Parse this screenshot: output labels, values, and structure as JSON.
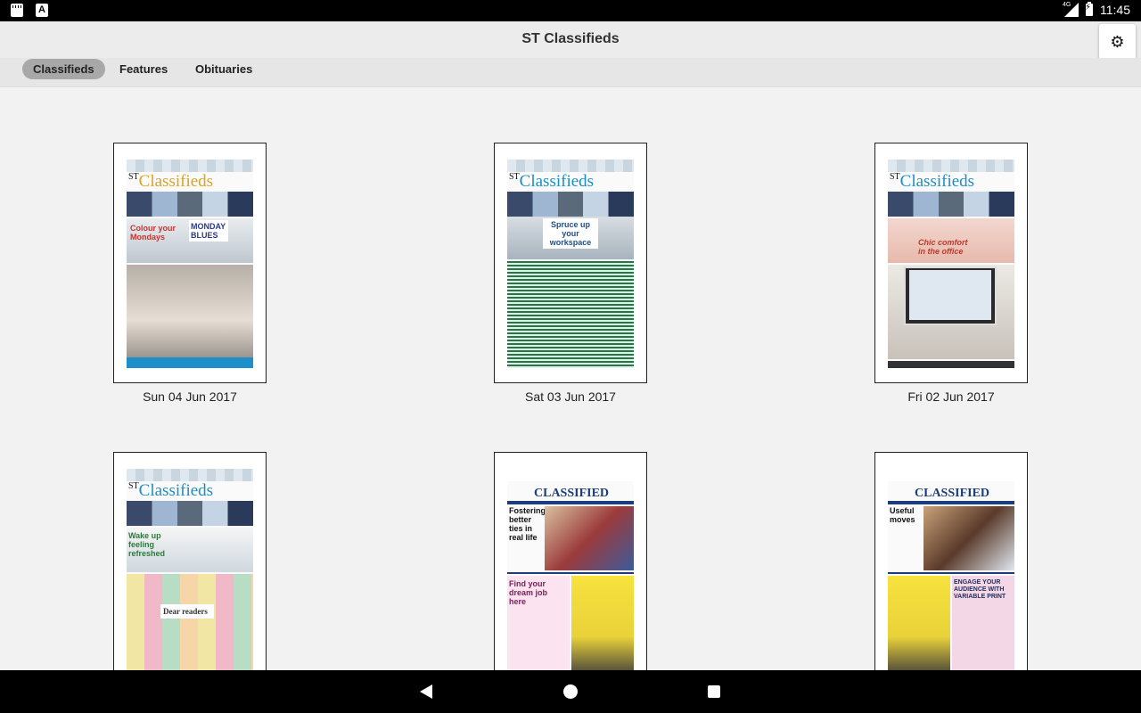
{
  "status_bar": {
    "time": "11:45",
    "network": "4G"
  },
  "header": {
    "title": "ST Classifieds",
    "settings_icon": "gear-icon"
  },
  "tabs": [
    {
      "label": "Classifieds",
      "active": true
    },
    {
      "label": "Features",
      "active": false
    },
    {
      "label": "Obituaries",
      "active": false
    }
  ],
  "editions": [
    {
      "date": "Sun 04 Jun 2017",
      "masthead": "Classifieds",
      "headline": "Colour your Mondays",
      "sub": "MONDAY BLUES"
    },
    {
      "date": "Sat 03 Jun 2017",
      "masthead": "Classifieds",
      "headline": "Spruce up your workspace",
      "sub": ""
    },
    {
      "date": "Fri 02 Jun 2017",
      "masthead": "Classifieds",
      "headline": "Chic comfort in the office",
      "sub": ""
    },
    {
      "date": "",
      "masthead": "Classifieds",
      "headline": "Wake up feeling refreshed",
      "sub": "Dear readers"
    },
    {
      "date": "",
      "masthead": "CLASSIFIED",
      "headline": "Fostering better ties in real life",
      "sub": "Find your dream job here"
    },
    {
      "date": "",
      "masthead": "CLASSIFIED",
      "headline": "Useful moves",
      "sub": "ENGAGE YOUR AUDIENCE WITH VARIABLE PRINT"
    }
  ]
}
